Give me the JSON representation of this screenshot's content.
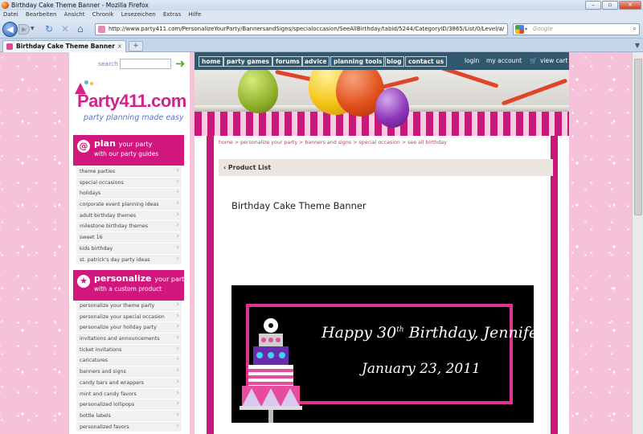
{
  "window": {
    "title": "Birthday Cake Theme Banner - Mozilla Firefox",
    "controls": [
      "–",
      "▫",
      "✕"
    ]
  },
  "menubar": [
    "Datei",
    "Bearbeiten",
    "Ansicht",
    "Chronik",
    "Lesezeichen",
    "Extras",
    "Hilfe"
  ],
  "nav": {
    "url": "http://www.party411.com/PersonalizeYourParty/BannersandSigns/specialoccasion/SeeAllBirthday/tabid/5244/CategoryID/3865/List/0/Level/a/",
    "search_placeholder": "Google"
  },
  "tab": {
    "title": "Birthday Cake Theme Banner",
    "new_tab": "+"
  },
  "site": {
    "search_label": "search",
    "logo_name": "Party411.com",
    "logo_tagline": "party planning made easy",
    "topnav": [
      "home",
      "party games",
      "forums",
      "advice",
      "planning tools",
      "blog",
      "contact us"
    ],
    "account": [
      "login",
      "my account",
      "view cart"
    ],
    "plan": {
      "title": "plan",
      "title_rest": "your party",
      "sub": "with our party guides",
      "items": [
        "theme parties",
        "special occasions",
        "holidays",
        "corporate event planning ideas",
        "adult birthday themes",
        "milestone birthday themes",
        "sweet 16",
        "kids birthday",
        "st. patrick's day party ideas"
      ]
    },
    "personalize": {
      "title": "personalize",
      "title_rest": "your party",
      "sub": "with a custom product",
      "items": [
        "personalize your theme party",
        "personalize your special occasion",
        "personalize your holiday party",
        "invitations and announcements",
        "ticket invitations",
        "caricatures",
        "banners and signs",
        "candy bars and wrappers",
        "mint and candy favors",
        "personalized lollipops",
        "bottle labels",
        "personalized favors"
      ]
    },
    "breadcrumb": "home > personalize your party > banners and signs > special occasion > see all birthday",
    "product_list": "‹ Product List",
    "product_title": "Birthday Cake Theme Banner",
    "banner": {
      "line1": "Happy 30",
      "line1_sup": "th",
      "line1_rest": " Birthday, Jennifer!",
      "line2": "January 23, 2011"
    }
  },
  "colors": {
    "brand_pink": "#d1177e",
    "nav_teal": "#32586d",
    "bg_pink": "#f5c2da"
  }
}
